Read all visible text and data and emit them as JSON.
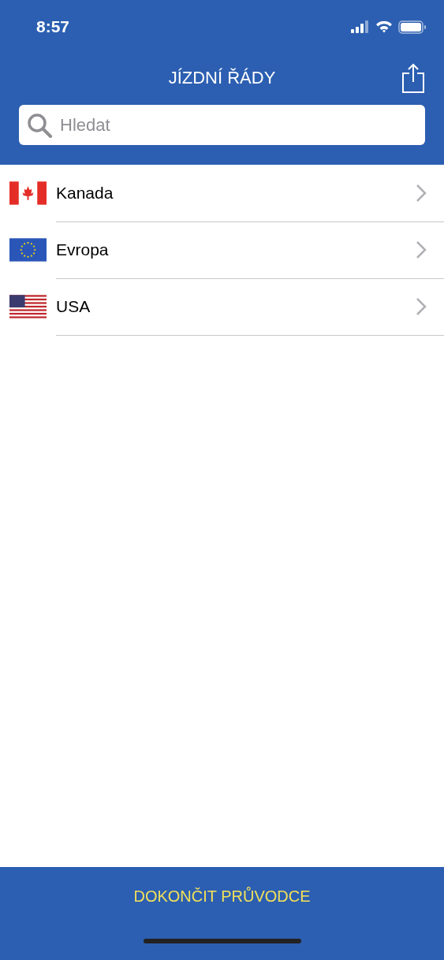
{
  "status_bar": {
    "time": "8:57"
  },
  "header": {
    "title": "JÍZDNÍ ŘÁDY"
  },
  "search": {
    "placeholder": "Hledat"
  },
  "countries": [
    {
      "name": "Kanada",
      "kind": "canada"
    },
    {
      "name": "Evropa",
      "kind": "eu"
    },
    {
      "name": "USA",
      "kind": "usa"
    }
  ],
  "footer": {
    "button": "DOKONČIT PRŮVODCE"
  }
}
